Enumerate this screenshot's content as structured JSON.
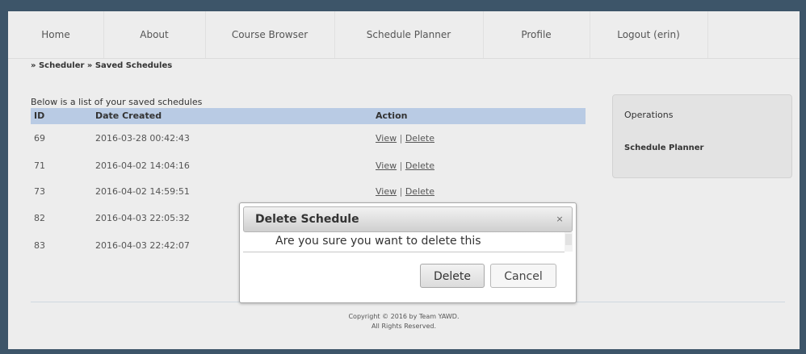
{
  "nav": {
    "items": [
      {
        "label": "Home"
      },
      {
        "label": "About"
      },
      {
        "label": "Course Browser"
      },
      {
        "label": "Schedule Planner"
      },
      {
        "label": "Profile"
      },
      {
        "label": "Logout (erin)"
      }
    ]
  },
  "breadcrumb": {
    "sep1": "»",
    "scheduler": "Scheduler",
    "sep2": "»",
    "current": "Saved Schedules"
  },
  "intro": "Below is a list of your saved schedules",
  "table": {
    "headers": {
      "id": "ID",
      "date": "Date Created",
      "action": "Action"
    },
    "rows": [
      {
        "id": "69",
        "date": "2016-03-28 00:42:43"
      },
      {
        "id": "71",
        "date": "2016-04-02 14:04:16"
      },
      {
        "id": "73",
        "date": "2016-04-02 14:59:51"
      },
      {
        "id": "82",
        "date": "2016-04-03 22:05:32"
      },
      {
        "id": "83",
        "date": "2016-04-03 22:42:07"
      }
    ],
    "view_label": "View",
    "sep": "|",
    "delete_label": "Delete"
  },
  "operations": {
    "title": "Operations",
    "link": "Schedule Planner"
  },
  "footer": {
    "line1": "Copyright © 2016 by Team YAWD.",
    "line2": "All Rights Reserved."
  },
  "dialog": {
    "title": "Delete Schedule",
    "close_icon": "×",
    "message": "Are you sure you want to delete this",
    "delete_button": "Delete",
    "cancel_button": "Cancel"
  },
  "colors": {
    "frame": "#3d5569",
    "page": "#ededed",
    "table_header": "#b9cbe4"
  }
}
